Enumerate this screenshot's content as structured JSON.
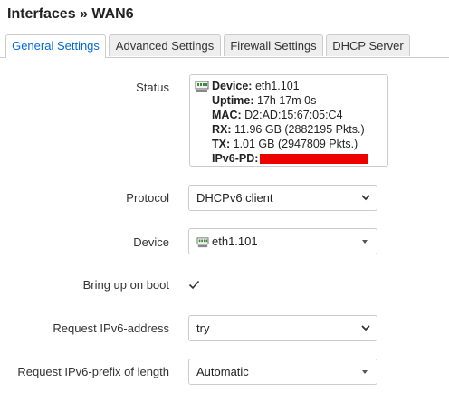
{
  "page": {
    "title": "Interfaces » WAN6"
  },
  "tabs": [
    {
      "label": "General Settings",
      "active": true
    },
    {
      "label": "Advanced Settings",
      "active": false
    },
    {
      "label": "Firewall Settings",
      "active": false
    },
    {
      "label": "DHCP Server",
      "active": false
    }
  ],
  "status": {
    "label": "Status",
    "icon": "network-port-icon",
    "device_key": "Device:",
    "device_val": "eth1.101",
    "uptime_key": "Uptime:",
    "uptime_val": "17h 17m 0s",
    "mac_key": "MAC:",
    "mac_val": "D2:AD:15:67:05:C4",
    "rx_key": "RX:",
    "rx_val": "11.96 GB (2882195 Pkts.)",
    "tx_key": "TX:",
    "tx_val": "1.01 GB (2947809 Pkts.)",
    "pd_key": "IPv6-PD:",
    "redaction_color": "#ee0000"
  },
  "protocol": {
    "label": "Protocol",
    "value": "DHCPv6 client"
  },
  "device": {
    "label": "Device",
    "value": "eth1.101",
    "icon": "network-port-icon"
  },
  "boot": {
    "label": "Bring up on boot",
    "checked": true
  },
  "request_address": {
    "label": "Request IPv6-address",
    "value": "try"
  },
  "request_prefix": {
    "label": "Request IPv6-prefix of length",
    "value": "Automatic"
  },
  "colors": {
    "accent": "#0069d6",
    "border": "#cccccc",
    "tab_bg": "#eeeeee"
  }
}
